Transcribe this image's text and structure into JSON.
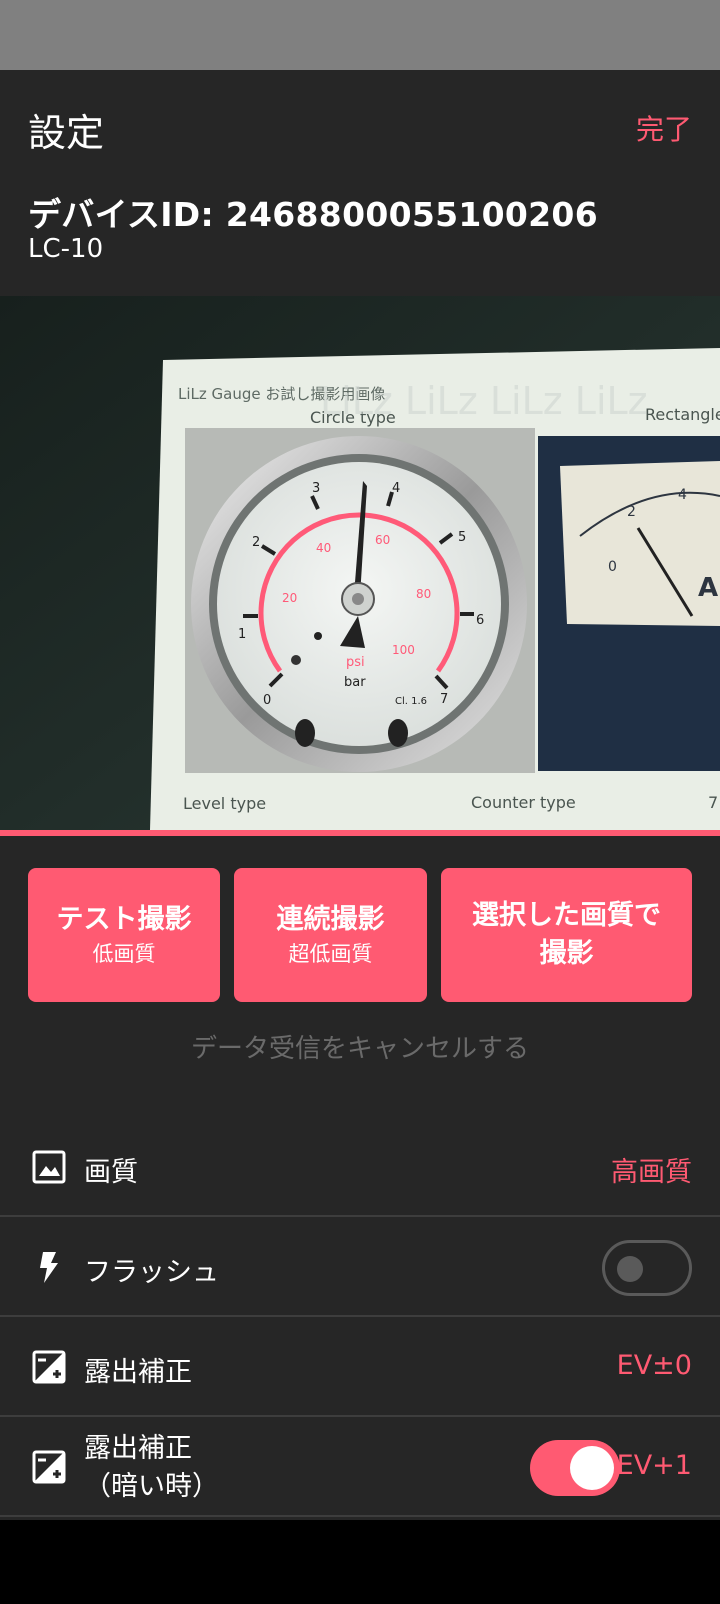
{
  "header": {
    "title": "設定",
    "done_label": "完了",
    "device_id": "デバイスID: 2468800055100206",
    "device_model": "LC-10"
  },
  "preview": {
    "card_title": "LiLz Gauge お試し撮影用画像",
    "circle_type": "Circle type",
    "rect_type": "Rectangle",
    "level_type": "Level type",
    "counter_type": "Counter type",
    "counter_num": "7",
    "watermark": "LiLz LiLz LiLz LiLz",
    "gauge_psi": "psi",
    "gauge_bar": "bar",
    "gauge_cl": "Cl. 1.6",
    "gauge_ticks_bar": [
      "0",
      "1",
      "2",
      "3",
      "4",
      "5",
      "6",
      "7"
    ],
    "gauge_ticks_psi": [
      "20",
      "40",
      "60",
      "80",
      "100"
    ],
    "meter_ticks": [
      "0",
      "2",
      "4"
    ],
    "meter_letter": "A"
  },
  "buttons": {
    "test": {
      "main": "テスト撮影",
      "sub": "低画質"
    },
    "continuous": {
      "main": "連続撮影",
      "sub": "超低画質"
    },
    "selected": {
      "line1": "選択した画質で",
      "line2": "撮影"
    }
  },
  "cancel_text": "データ受信をキャンセルする",
  "settings": {
    "quality": {
      "label": "画質",
      "value": "高画質",
      "icon": "image-icon"
    },
    "flash": {
      "label": "フラッシュ",
      "enabled": false,
      "icon": "flash-icon"
    },
    "exposure": {
      "label": "露出補正",
      "value": "EV±0",
      "icon": "exposure-icon"
    },
    "exposure_dark": {
      "label_line1": "露出補正",
      "label_line2": "（暗い時）",
      "value": "EV+1",
      "enabled": true,
      "icon": "exposure-icon"
    }
  },
  "colors": {
    "accent": "#ff5a72",
    "sheet": "#262626",
    "divider": "#3d3d3d"
  }
}
